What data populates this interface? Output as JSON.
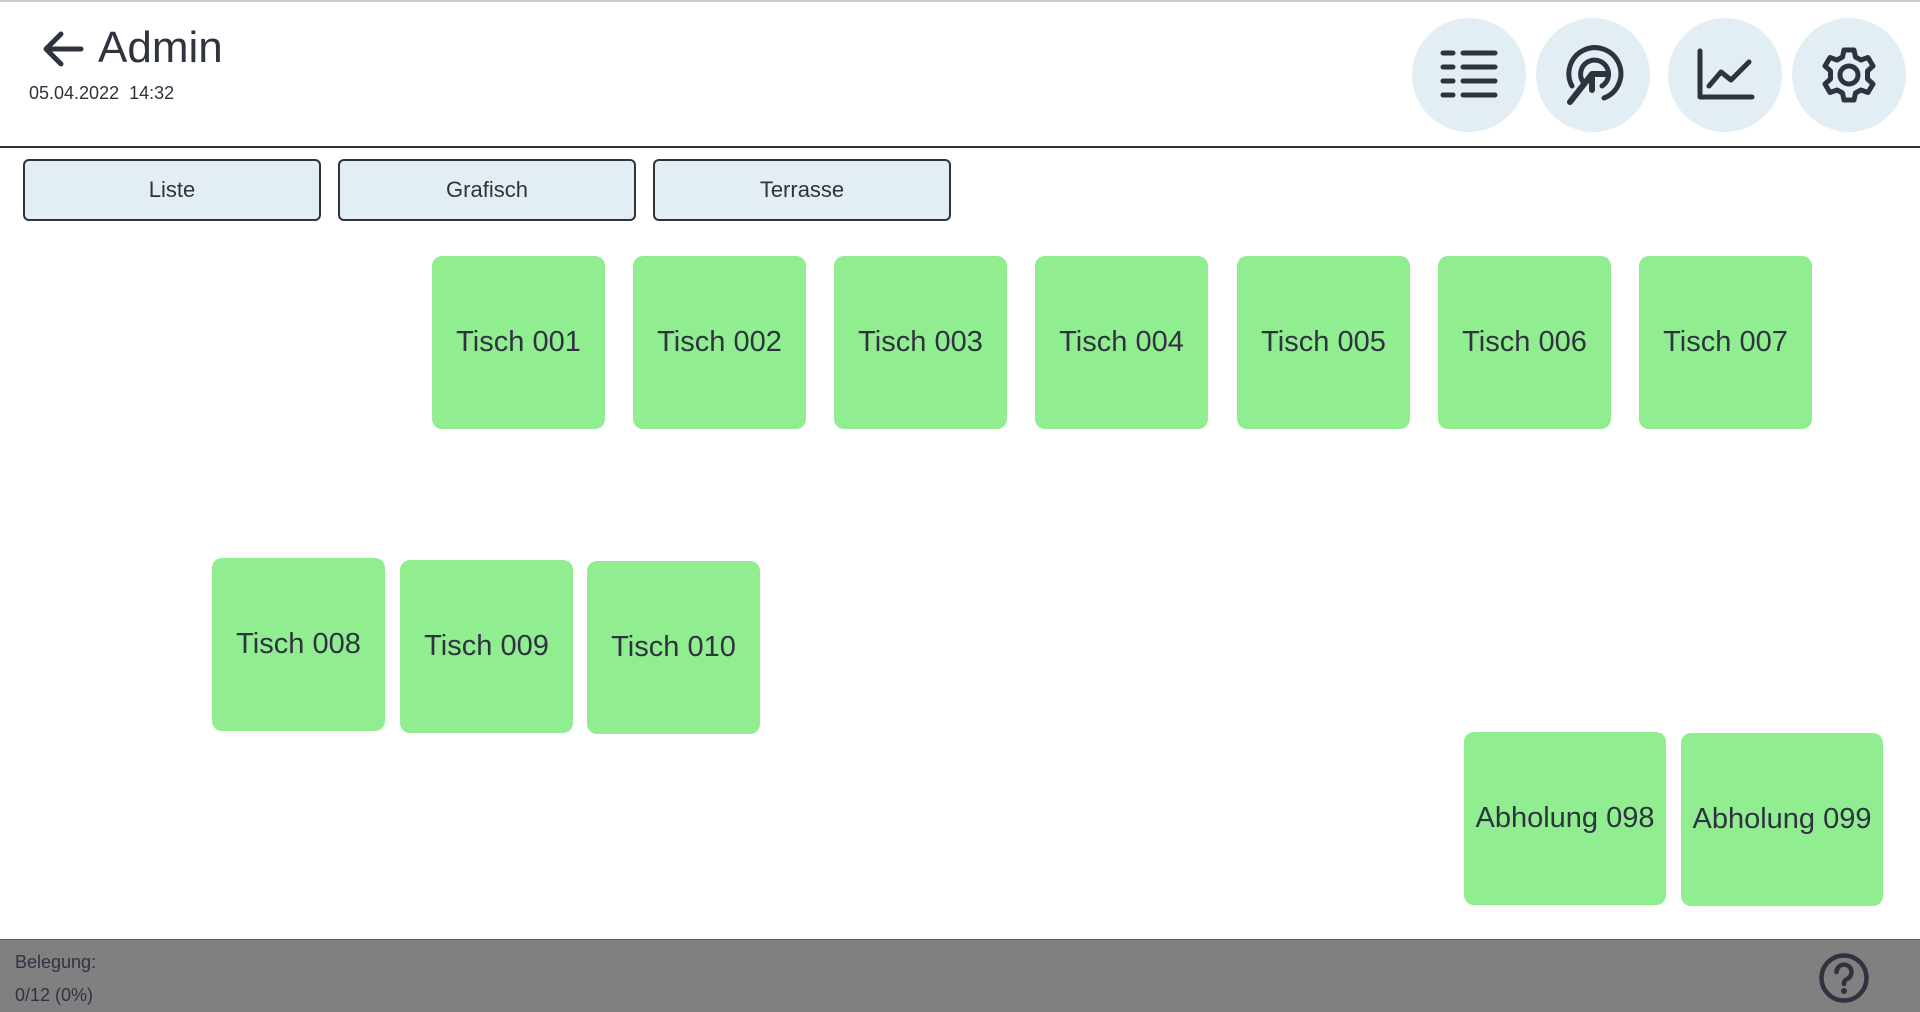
{
  "header": {
    "title": "Admin",
    "datetime": "05.04.2022  14:32",
    "back_icon": "arrow-left-icon",
    "actions": [
      {
        "name": "list-view-button",
        "icon": "list-icon"
      },
      {
        "name": "touch-button",
        "icon": "tap-icon"
      },
      {
        "name": "statistics-button",
        "icon": "chart-line-icon"
      },
      {
        "name": "settings-button",
        "icon": "gear-icon"
      }
    ]
  },
  "tabs": [
    {
      "label": "Liste"
    },
    {
      "label": "Grafisch"
    },
    {
      "label": "Terrasse"
    }
  ],
  "tables": [
    {
      "label": "Tisch 001",
      "status": "free"
    },
    {
      "label": "Tisch 002",
      "status": "free"
    },
    {
      "label": "Tisch 003",
      "status": "free"
    },
    {
      "label": "Tisch 004",
      "status": "free"
    },
    {
      "label": "Tisch 005",
      "status": "free"
    },
    {
      "label": "Tisch 006",
      "status": "free"
    },
    {
      "label": "Tisch 007",
      "status": "free"
    },
    {
      "label": "Tisch 008",
      "status": "free"
    },
    {
      "label": "Tisch 009",
      "status": "free"
    },
    {
      "label": "Tisch 010",
      "status": "free"
    },
    {
      "label": "Abholung 098",
      "status": "free"
    },
    {
      "label": "Abholung 099",
      "status": "free"
    }
  ],
  "footer": {
    "occupancy_label": "Belegung:",
    "occupancy_value": "0/12 (0%)",
    "help_icon": "help-circle-icon"
  },
  "colors": {
    "free_table": "#90ee90",
    "button_bg": "#e2eef4",
    "text": "#2f3340",
    "footer_bg": "#808080"
  }
}
